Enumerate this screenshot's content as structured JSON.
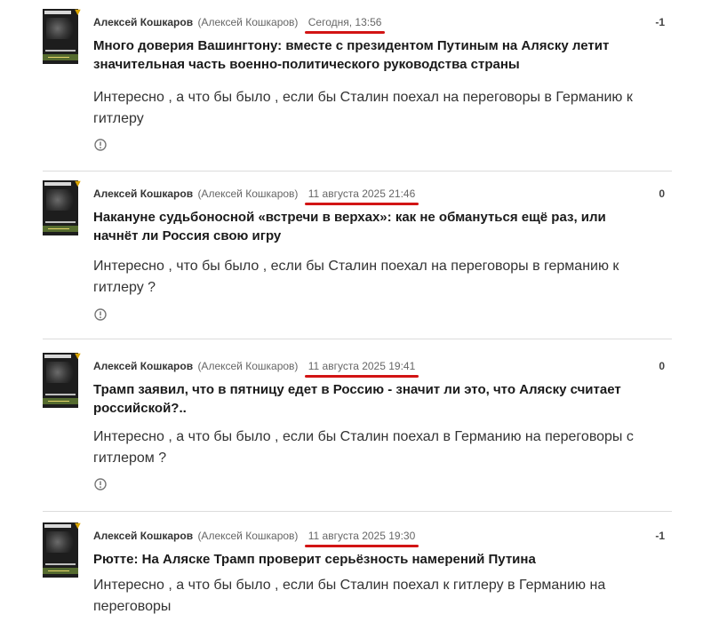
{
  "comments": [
    {
      "author": "Алексей Кошкаров",
      "author_alias": "(Алексей Кошкаров)",
      "date": "Сегодня, 13:56",
      "score": "-1",
      "title": "Много доверия Вашингтону: вместе с президентом Путиным на Аляску летит значительная часть военно-политического руководства страны",
      "text": "Интересно , а что бы было , если бы Сталин поехал на переговоры в Германию к гитлеру"
    },
    {
      "author": "Алексей Кошкаров",
      "author_alias": "(Алексей Кошкаров)",
      "date": "11 августа 2025 21:46",
      "score": "0",
      "title": "Накануне судьбоносной «встречи в верхах»: как не обмануться ещё раз, или начнёт ли Россия свою игру",
      "text": "Интересно , что бы было , если бы Сталин поехал на переговоры в германию к гитлеру ?"
    },
    {
      "author": "Алексей Кошкаров",
      "author_alias": "(Алексей Кошкаров)",
      "date": "11 августа 2025 19:41",
      "score": "0",
      "title": "Трамп заявил, что в пятницу едет в Россию - значит ли это, что Аляску считает российской?..",
      "text": "Интересно , а что бы было , если бы Сталин поехал в Германию на переговоры с гитлером ?"
    },
    {
      "author": "Алексей Кошкаров",
      "author_alias": "(Алексей Кошкаров)",
      "date": "11 августа 2025 19:30",
      "score": "-1",
      "title": "Рютте: На Аляске Трамп проверит серьёзность намерений Путина",
      "text": "Интересно , а что бы было , если бы Сталин поехал к гитлеру в Германию на переговоры"
    }
  ],
  "icons": {
    "report": "report-icon",
    "badge": "verified-badge-icon"
  },
  "colors": {
    "date_highlight": "#d21414",
    "badge": "#d9a400"
  }
}
